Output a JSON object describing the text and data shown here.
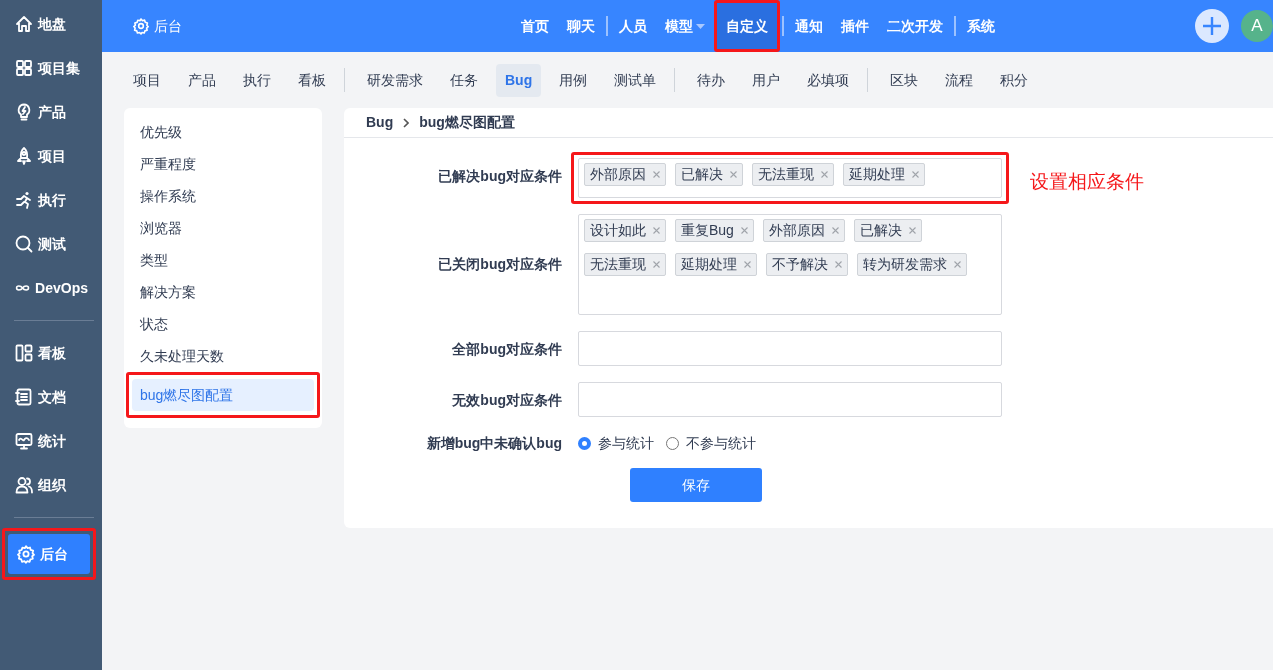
{
  "sidebar": {
    "groups": [
      [
        {
          "label": "地盘",
          "selected": false,
          "annotated": false
        },
        {
          "label": "项目集",
          "selected": false,
          "annotated": false
        },
        {
          "label": "产品",
          "selected": false,
          "annotated": false
        },
        {
          "label": "项目",
          "selected": false,
          "annotated": false
        },
        {
          "label": "执行",
          "selected": false,
          "annotated": false
        },
        {
          "label": "测试",
          "selected": false,
          "annotated": false
        },
        {
          "label": "DevOps",
          "selected": false,
          "annotated": false
        }
      ],
      [
        {
          "label": "看板",
          "selected": false,
          "annotated": false
        },
        {
          "label": "文档",
          "selected": false,
          "annotated": false
        },
        {
          "label": "统计",
          "selected": false,
          "annotated": false
        },
        {
          "label": "组织",
          "selected": false,
          "annotated": false
        }
      ],
      [
        {
          "label": "后台",
          "selected": true,
          "annotated": true
        }
      ]
    ]
  },
  "topbar": {
    "title": "后台",
    "nav_groups": [
      [
        {
          "label": "首页",
          "selected": false,
          "annotated": false,
          "dropdown": false
        },
        {
          "label": "聊天",
          "selected": false,
          "annotated": false,
          "dropdown": false
        }
      ],
      [
        {
          "label": "人员",
          "selected": false,
          "annotated": false,
          "dropdown": false
        },
        {
          "label": "模型",
          "selected": false,
          "annotated": false,
          "dropdown": true
        },
        {
          "label": "自定义",
          "selected": true,
          "annotated": true,
          "dropdown": false
        }
      ],
      [
        {
          "label": "通知",
          "selected": false,
          "annotated": false,
          "dropdown": false
        },
        {
          "label": "插件",
          "selected": false,
          "annotated": false,
          "dropdown": false
        },
        {
          "label": "二次开发",
          "selected": false,
          "annotated": false,
          "dropdown": false
        }
      ],
      [
        {
          "label": "系统",
          "selected": false,
          "annotated": false,
          "dropdown": false
        }
      ]
    ],
    "avatar": "A"
  },
  "subnav": {
    "groups": [
      [
        {
          "label": "项目",
          "selected": false
        },
        {
          "label": "产品",
          "selected": false
        },
        {
          "label": "执行",
          "selected": false
        },
        {
          "label": "看板",
          "selected": false
        }
      ],
      [
        {
          "label": "研发需求",
          "selected": false
        },
        {
          "label": "任务",
          "selected": false
        },
        {
          "label": "Bug",
          "selected": true
        },
        {
          "label": "用例",
          "selected": false
        },
        {
          "label": "测试单",
          "selected": false
        }
      ],
      [
        {
          "label": "待办",
          "selected": false
        },
        {
          "label": "用户",
          "selected": false
        },
        {
          "label": "必填项",
          "selected": false
        }
      ],
      [
        {
          "label": "区块",
          "selected": false
        },
        {
          "label": "流程",
          "selected": false
        },
        {
          "label": "积分",
          "selected": false
        }
      ]
    ]
  },
  "settings_menu": {
    "items": [
      {
        "label": "优先级",
        "selected": false,
        "annotated": false
      },
      {
        "label": "严重程度",
        "selected": false,
        "annotated": false
      },
      {
        "label": "操作系统",
        "selected": false,
        "annotated": false
      },
      {
        "label": "浏览器",
        "selected": false,
        "annotated": false
      },
      {
        "label": "类型",
        "selected": false,
        "annotated": false
      },
      {
        "label": "解决方案",
        "selected": false,
        "annotated": false
      },
      {
        "label": "状态",
        "selected": false,
        "annotated": false
      },
      {
        "label": "久未处理天数",
        "selected": false,
        "annotated": false
      },
      {
        "label": "bug燃尽图配置",
        "selected": true,
        "annotated": true
      }
    ]
  },
  "breadcrumb": [
    "Bug",
    "bug燃尽图配置"
  ],
  "form": {
    "rows": [
      {
        "kind": "tags",
        "label": "已解决bug对应条件",
        "annotated": true,
        "tall": false,
        "tags": [
          "外部原因",
          "已解决",
          "无法重现",
          "延期处理"
        ]
      },
      {
        "kind": "tags",
        "label": "已关闭bug对应条件",
        "annotated": false,
        "tall": true,
        "tags": [
          "设计如此",
          "重复Bug",
          "外部原因",
          "已解决",
          "无法重现",
          "延期处理",
          "不予解决",
          "转为研发需求"
        ]
      },
      {
        "kind": "tags",
        "label": "全部bug对应条件",
        "annotated": false,
        "tall": false,
        "tags": []
      },
      {
        "kind": "tags",
        "label": "无效bug对应条件",
        "annotated": false,
        "tall": false,
        "tags": []
      },
      {
        "kind": "radio",
        "label": "新增bug中未确认bug",
        "options": [
          {
            "label": "参与统计",
            "selected": true
          },
          {
            "label": "不参与统计",
            "selected": false
          }
        ]
      }
    ],
    "save_button": "保存"
  },
  "annotation_note": "设置相应条件"
}
